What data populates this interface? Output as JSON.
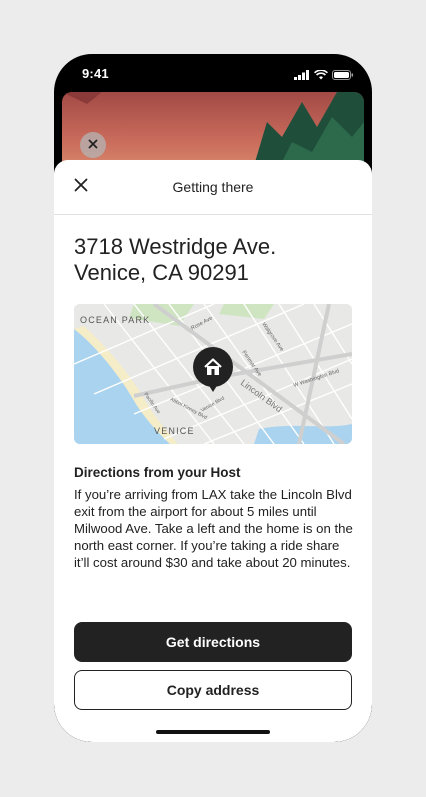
{
  "status_bar": {
    "time": "9:41",
    "icons": [
      "signal-icon",
      "wifi-icon",
      "battery-icon"
    ]
  },
  "backdrop": {
    "close_icon": "close-icon"
  },
  "sheet": {
    "title": "Getting there",
    "close_icon": "close-icon"
  },
  "address": {
    "line1": "3718 Westridge Ave.",
    "line2": "Venice, CA 90291"
  },
  "map": {
    "marker_icon": "home-icon",
    "labels": {
      "ocean_park": "OCEAN PARK",
      "venice": "VENICE",
      "rose_ave": "Rose Ave",
      "walgrove_ave": "Walgrove Ave",
      "penmar_ave": "Penmar Ave",
      "lincoln_blvd": "Lincoln Blvd",
      "w_washington_blvd": "W Washington Blvd",
      "abbot_kinney_blvd": "Abbot Kinney Blvd",
      "venice_blvd": "Venice Blvd",
      "pacific_ave": "Pacific Ave"
    },
    "colors": {
      "land": "#e8e8e6",
      "water": "#a9d3ee",
      "beach": "#f5ecc8",
      "park": "#cfe5c2",
      "marker": "#222222"
    }
  },
  "directions": {
    "heading": "Directions from your Host",
    "body": "If you’re arriving from LAX take the Lincoln Blvd exit from the airport for about 5 miles until Milwood Ave. Take a left and the home is on the north east corner. If you’re taking a ride share it’ll cost around $30 and take about 20 minutes."
  },
  "buttons": {
    "get_directions": "Get directions",
    "copy_address": "Copy address"
  }
}
